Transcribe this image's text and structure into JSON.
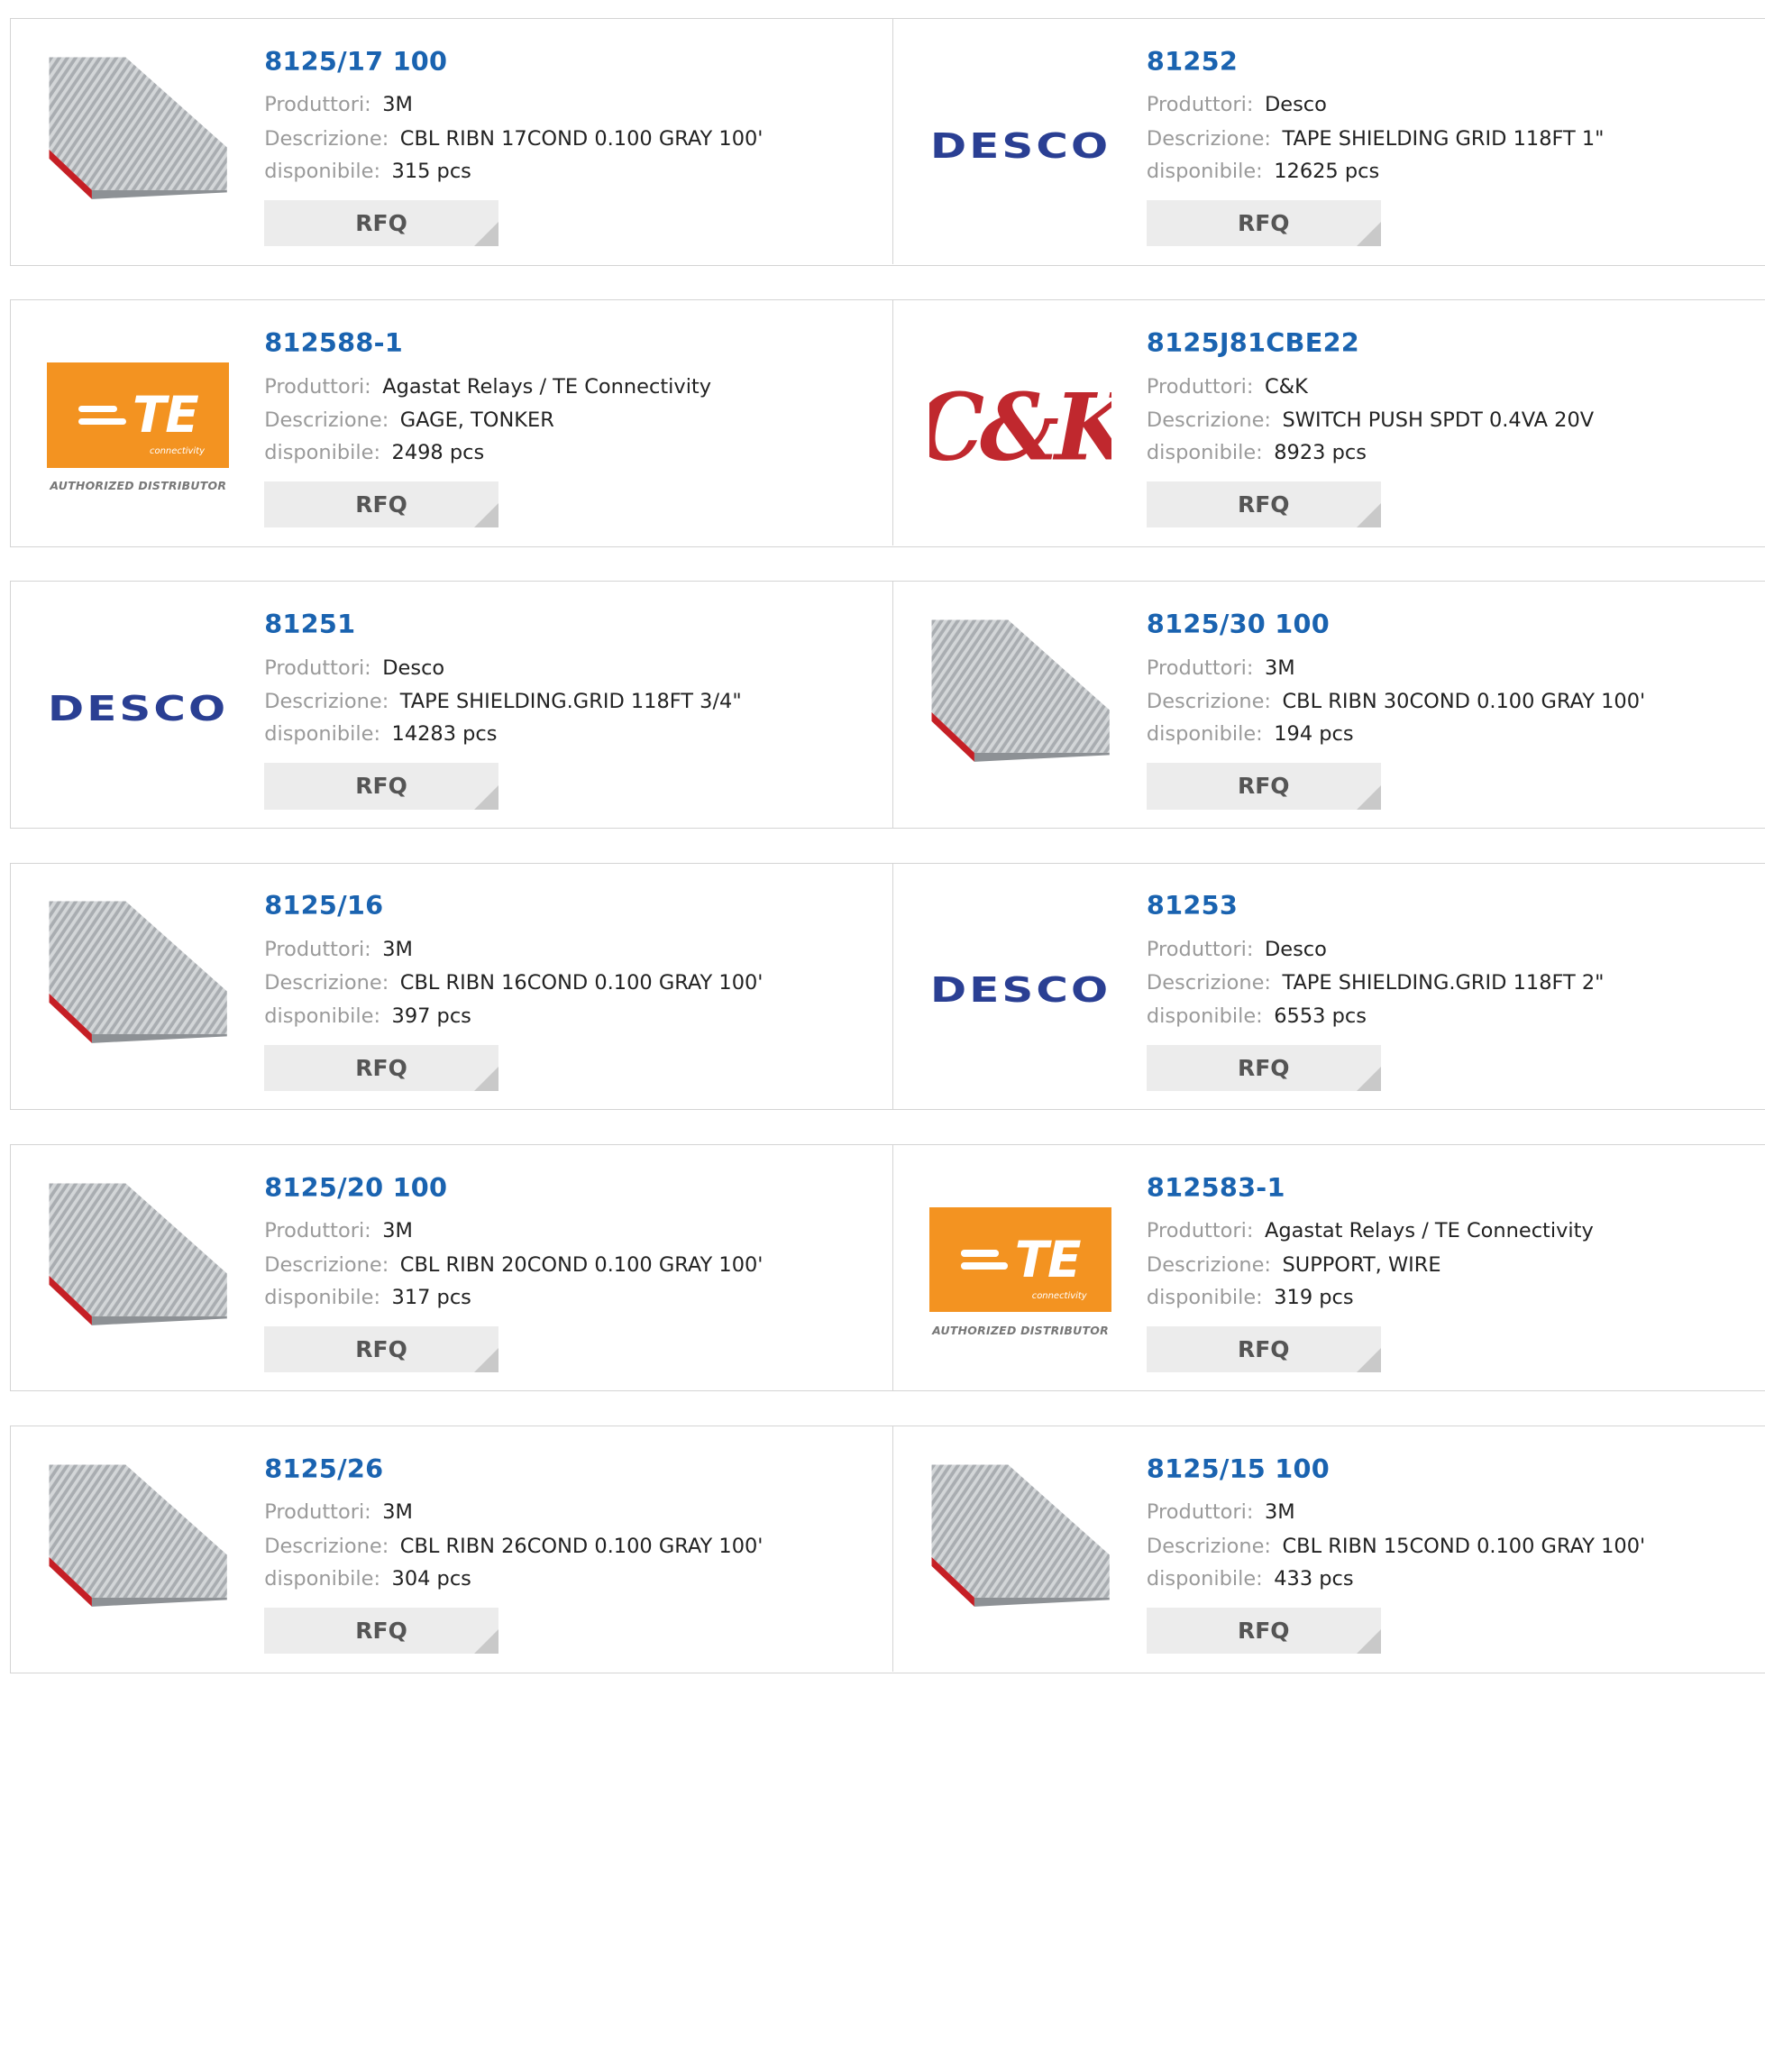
{
  "labels": {
    "manufacturer": "Produttori:",
    "description": "Descrizione:",
    "available": "disponibile:",
    "rfq": "RFQ"
  },
  "logos": {
    "desco": "DESCO",
    "te_mark": "TE",
    "te_sub": "connectivity",
    "te_authorized": "AUTHORIZED DISTRIBUTOR",
    "ck": "C&K"
  },
  "products": [
    {
      "title": "8125/17 100",
      "manufacturer": "3M",
      "description": "CBL RIBN 17COND 0.100 GRAY 100'",
      "available": "315 pcs",
      "image": "ribbon-cable"
    },
    {
      "title": "81252",
      "manufacturer": "Desco",
      "description": "TAPE SHIELDING GRID 118FT 1\"",
      "available": "12625 pcs",
      "image": "desco-logo"
    },
    {
      "title": "812588-1",
      "manufacturer": "Agastat Relays / TE Connectivity",
      "description": "GAGE, TONKER",
      "available": "2498 pcs",
      "image": "te-logo"
    },
    {
      "title": "8125J81CBE22",
      "manufacturer": "C&K",
      "description": "SWITCH PUSH SPDT 0.4VA 20V",
      "available": "8923 pcs",
      "image": "ck-logo"
    },
    {
      "title": "81251",
      "manufacturer": "Desco",
      "description": "TAPE SHIELDING.GRID 118FT 3/4\"",
      "available": "14283 pcs",
      "image": "desco-logo"
    },
    {
      "title": "8125/30 100",
      "manufacturer": "3M",
      "description": "CBL RIBN 30COND 0.100 GRAY 100'",
      "available": "194 pcs",
      "image": "ribbon-cable"
    },
    {
      "title": "8125/16",
      "manufacturer": "3M",
      "description": "CBL RIBN 16COND 0.100 GRAY 100'",
      "available": "397 pcs",
      "image": "ribbon-cable"
    },
    {
      "title": "81253",
      "manufacturer": "Desco",
      "description": "TAPE SHIELDING.GRID 118FT 2\"",
      "available": "6553 pcs",
      "image": "desco-logo"
    },
    {
      "title": "8125/20 100",
      "manufacturer": "3M",
      "description": "CBL RIBN 20COND 0.100 GRAY 100'",
      "available": "317 pcs",
      "image": "ribbon-cable"
    },
    {
      "title": "812583-1",
      "manufacturer": "Agastat Relays / TE Connectivity",
      "description": "SUPPORT, WIRE",
      "available": "319 pcs",
      "image": "te-logo"
    },
    {
      "title": "8125/26",
      "manufacturer": "3M",
      "description": "CBL RIBN 26COND 0.100 GRAY 100'",
      "available": "304 pcs",
      "image": "ribbon-cable"
    },
    {
      "title": "8125/15 100",
      "manufacturer": "3M",
      "description": "CBL RIBN 15COND 0.100 GRAY 100'",
      "available": "433 pcs",
      "image": "ribbon-cable"
    }
  ]
}
